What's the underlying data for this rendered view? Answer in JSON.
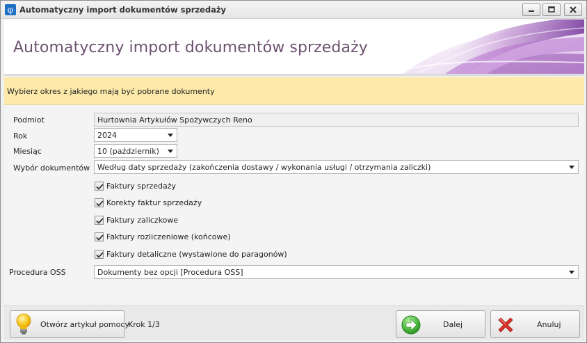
{
  "window": {
    "title": "Automatyczny import dokumentów sprzedaży",
    "app_icon_glyph": "φ"
  },
  "banner": {
    "title": "Automatyczny import dokumentów sprzedaży"
  },
  "hint": {
    "text": "Wybierz okres z jakiego mają być pobrane dokumenty"
  },
  "form": {
    "podmiot": {
      "label": "Podmiot",
      "value": "Hurtownia Artykułów Spożywczych Reno"
    },
    "rok": {
      "label": "Rok",
      "value": "2024"
    },
    "miesiac": {
      "label": "Miesiąc",
      "value": "10 (październik)"
    },
    "wybor": {
      "label": "Wybór dokumentów",
      "value": "Według daty sprzedaży (zakończenia dostawy / wykonania usługi / otrzymania zaliczki)"
    },
    "checkboxes": [
      {
        "label": "Faktury sprzedaży",
        "checked": true
      },
      {
        "label": "Korekty faktur sprzedaży",
        "checked": true
      },
      {
        "label": "Faktury zaliczkowe",
        "checked": true
      },
      {
        "label": "Faktury rozliczeniowe (końcowe)",
        "checked": true
      },
      {
        "label": "Faktury detaliczne (wystawione do paragonów)",
        "checked": true
      }
    ],
    "oss": {
      "label": "Procedura OSS",
      "value": "Dokumenty bez opcji [Procedura OSS]"
    }
  },
  "footer": {
    "help_label": "Otwórz artykuł pomocy",
    "step": "Krok 1/3",
    "next_label": "Dalej",
    "cancel_label": "Anuluj"
  },
  "icons": {
    "help": "lightbulb-icon",
    "next": "arrow-right-icon",
    "cancel": "red-x-icon"
  },
  "colors": {
    "banner_title": "#6d5270",
    "hint_bg": "#fdeaaa",
    "accent_purple": "#9b59b6",
    "next_green": "#3ea83a",
    "cancel_red": "#d9342b"
  }
}
